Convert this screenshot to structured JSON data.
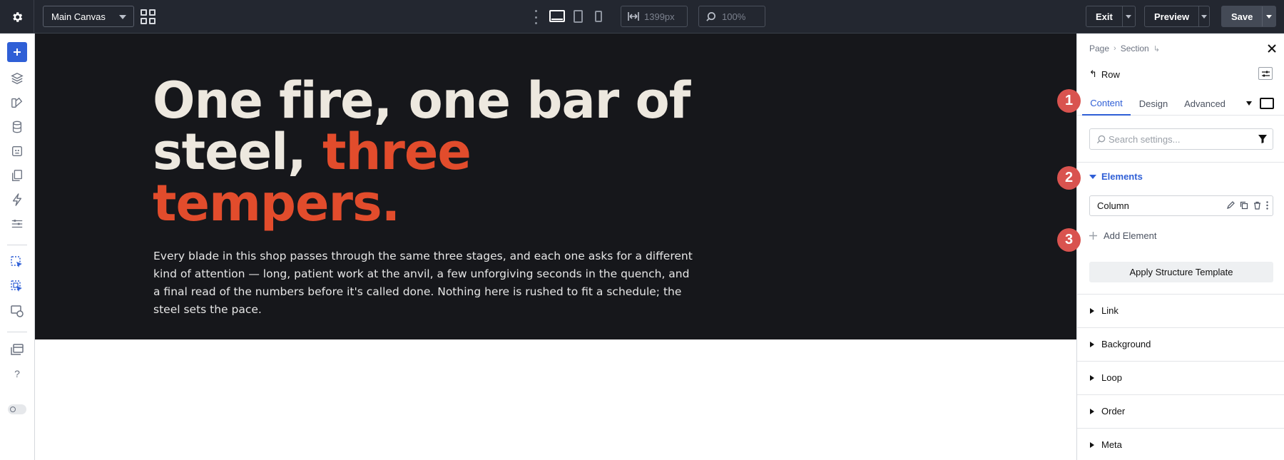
{
  "topbar": {
    "canvas_select": "Main Canvas",
    "width_value": "1399px",
    "zoom_value": "100%",
    "exit_label": "Exit",
    "preview_label": "Preview",
    "save_label": "Save"
  },
  "hero": {
    "title_part1": "One fire, one bar of steel, ",
    "title_accent": "three tempers.",
    "body": "Every blade in this shop passes through the same three stages, and each one asks for a different kind of attention — long, patient work at the anvil, a few unforgiving seconds in the quench, and a final read of the numbers before it's called done. Nothing here is rushed to fit a schedule; the steel sets the pace.",
    "accent_color": "#e24c2c"
  },
  "panel": {
    "breadcrumb": [
      "Page",
      "Section"
    ],
    "element_label": "Row",
    "tabs": [
      "Content",
      "Design",
      "Advanced"
    ],
    "search_placeholder": "Search settings...",
    "elements_title": "Elements",
    "column_label": "Column",
    "add_element_label": "Add Element",
    "apply_template_label": "Apply Structure Template",
    "sections": [
      "Link",
      "Background",
      "Loop",
      "Order",
      "Meta"
    ]
  },
  "callouts": [
    "1",
    "2",
    "3"
  ],
  "colors": {
    "accent": "#2f5fd6",
    "callout": "#d9534f",
    "topbar": "#232730"
  }
}
